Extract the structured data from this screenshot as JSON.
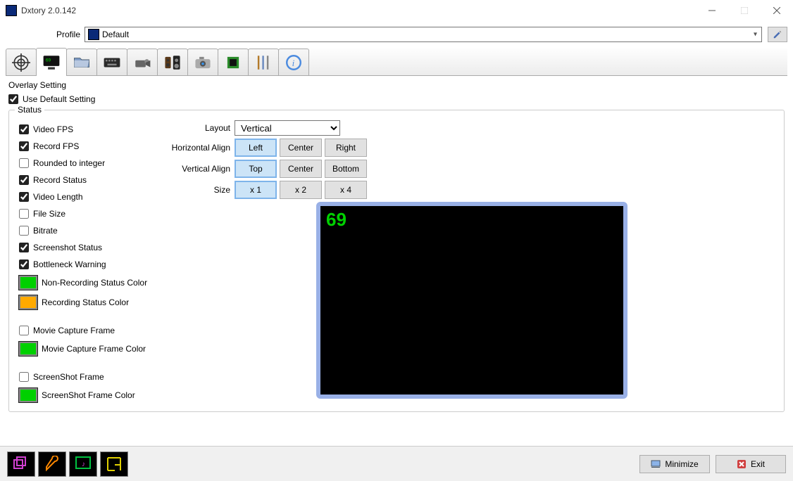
{
  "window": {
    "title": "Dxtory 2.0.142"
  },
  "profile": {
    "label": "Profile",
    "selected": "Default"
  },
  "overlay": {
    "title": "Overlay Setting",
    "use_default": {
      "label": "Use Default Setting",
      "checked": true
    }
  },
  "status": {
    "legend": "Status",
    "video_fps": {
      "label": "Video FPS",
      "checked": true
    },
    "record_fps": {
      "label": "Record FPS",
      "checked": true
    },
    "round_int": {
      "label": "Rounded to integer",
      "checked": false
    },
    "record_status": {
      "label": "Record Status",
      "checked": true
    },
    "video_length": {
      "label": "Video Length",
      "checked": true
    },
    "file_size": {
      "label": "File Size",
      "checked": false
    },
    "bitrate": {
      "label": "Bitrate",
      "checked": false
    },
    "screenshot_status": {
      "label": "Screenshot Status",
      "checked": true
    },
    "bottleneck": {
      "label": "Bottleneck Warning",
      "checked": true
    },
    "non_rec_color": {
      "label": "Non-Recording Status Color",
      "color": "#00d000"
    },
    "rec_color": {
      "label": "Recording Status Color",
      "color": "#ffaa00"
    },
    "movie_frame": {
      "label": "Movie Capture Frame",
      "checked": false
    },
    "movie_frame_color": {
      "label": "Movie Capture Frame Color",
      "color": "#00d000"
    },
    "ss_frame": {
      "label": "ScreenShot Frame",
      "checked": false
    },
    "ss_frame_color": {
      "label": "ScreenShot Frame Color",
      "color": "#00d000"
    }
  },
  "layout": {
    "label": "Layout",
    "value": "Vertical",
    "halign_label": "Horizontal Align",
    "halign": {
      "left": "Left",
      "center": "Center",
      "right": "Right",
      "active": "left"
    },
    "valign_label": "Vertical Align",
    "valign": {
      "top": "Top",
      "center": "Center",
      "bottom": "Bottom",
      "active": "top"
    },
    "size_label": "Size",
    "size": {
      "x1": "x 1",
      "x2": "x 2",
      "x4": "x 4",
      "active": "x1"
    }
  },
  "preview": {
    "fps": "69"
  },
  "bottombar": {
    "minimize": "Minimize",
    "exit": "Exit"
  }
}
